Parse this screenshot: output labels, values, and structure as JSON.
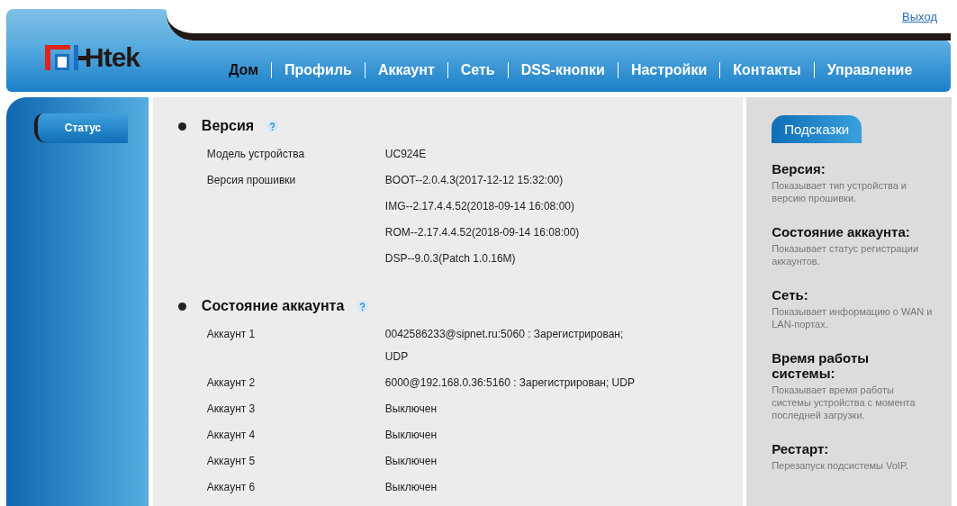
{
  "logout_link": "Выход",
  "logo": {
    "text": "Htek"
  },
  "nav": [
    {
      "label": "Дом",
      "selected": true
    },
    {
      "label": "Профиль",
      "selected": false
    },
    {
      "label": "Аккаунт",
      "selected": false
    },
    {
      "label": "Сеть",
      "selected": false
    },
    {
      "label": "DSS-кнопки",
      "selected": false
    },
    {
      "label": "Настройки",
      "selected": false
    },
    {
      "label": "Контакты",
      "selected": false
    },
    {
      "label": "Управление",
      "selected": false
    }
  ],
  "sidebar": {
    "items": [
      {
        "label": "Статус",
        "selected": true
      }
    ]
  },
  "sections": [
    {
      "title": "Версия",
      "rows": [
        {
          "label": "Модель устройства",
          "values": [
            "UC924E"
          ]
        },
        {
          "label": "Версия прошивки",
          "values": [
            "BOOT--2.0.4.3(2017-12-12 15:32:00)",
            "IMG--2.17.4.4.52(2018-09-14 16:08:00)",
            "ROM--2.17.4.4.52(2018-09-14 16:08:00)",
            "DSP--9.0.3(Patch 1.0.16M)"
          ]
        }
      ]
    },
    {
      "title": "Состояние аккаунта",
      "rows": [
        {
          "label": "Аккаунт 1",
          "values": [
            "0042586233@sipnet.ru:5060 : Зарегистрирован; UDP"
          ]
        },
        {
          "label": "Аккаунт 2",
          "values": [
            "6000@192.168.0.36:5160 : Зарегистрирован; UDP"
          ]
        },
        {
          "label": "Аккаунт 3",
          "values": [
            "Выключен"
          ]
        },
        {
          "label": "Аккаунт 4",
          "values": [
            "Выключен"
          ]
        },
        {
          "label": "Аккаунт 5",
          "values": [
            "Выключен"
          ]
        },
        {
          "label": "Аккаунт 6",
          "values": [
            "Выключен"
          ]
        }
      ]
    }
  ],
  "hints": {
    "title": "Подсказки",
    "items": [
      {
        "title": "Версия:",
        "text": "Показывает тип устройства и версию прошивки."
      },
      {
        "title": "Состояние аккаунта:",
        "text": "Показывает статус регистрации аккаунтов."
      },
      {
        "title": "Сеть:",
        "text": "Показывает информацию о WAN и LAN-портах."
      },
      {
        "title": "Время работы системы:",
        "text": "Показывает время работы системы устройства с момента последней загрузки."
      },
      {
        "title": "Рестарт:",
        "text": "Перезапуск подсистемы VoIP."
      }
    ]
  }
}
